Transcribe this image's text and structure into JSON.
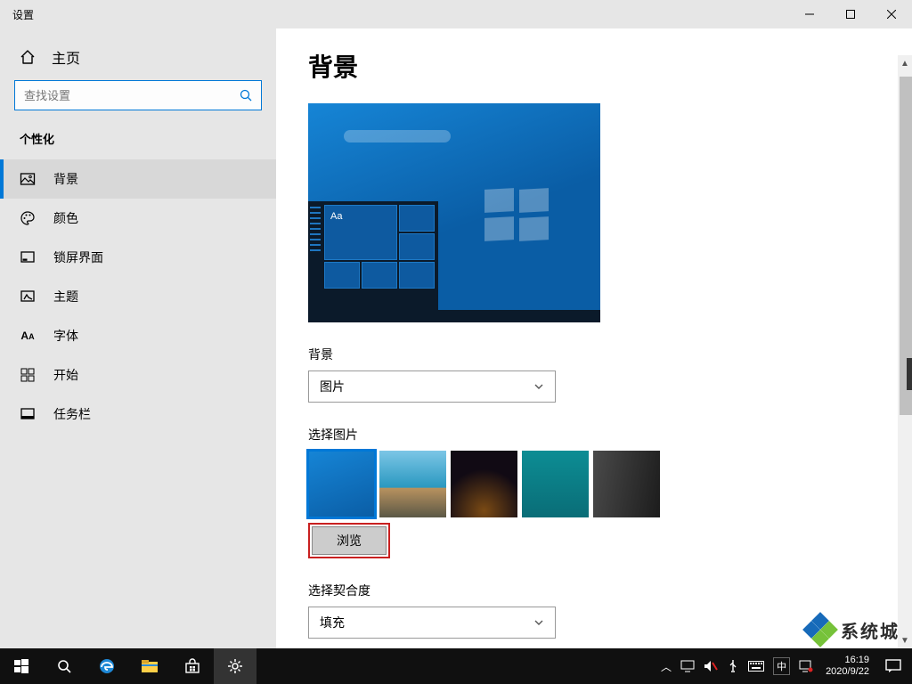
{
  "window": {
    "title": "设置"
  },
  "title_controls": {
    "min": "minimize",
    "max": "maximize",
    "close": "close"
  },
  "sidebar": {
    "home_label": "主页",
    "search_placeholder": "查找设置",
    "section": "个性化",
    "items": [
      {
        "label": "背景",
        "icon": "picture-icon",
        "active": true
      },
      {
        "label": "颜色",
        "icon": "palette-icon",
        "active": false
      },
      {
        "label": "锁屏界面",
        "icon": "lockscreen-icon",
        "active": false
      },
      {
        "label": "主题",
        "icon": "theme-icon",
        "active": false
      },
      {
        "label": "字体",
        "icon": "font-icon",
        "active": false
      },
      {
        "label": "开始",
        "icon": "start-icon",
        "active": false
      },
      {
        "label": "任务栏",
        "icon": "taskbar-icon",
        "active": false
      }
    ]
  },
  "content": {
    "heading": "背景",
    "preview_sample_text": "Aa",
    "background_label": "背景",
    "background_value": "图片",
    "choose_picture_label": "选择图片",
    "browse_label": "浏览",
    "fit_label": "选择契合度",
    "fit_value": "填充"
  },
  "taskbar": {
    "tray_lang": "中",
    "time": "16:19",
    "date": "2020/9/22"
  },
  "watermark": {
    "text": "系统城"
  }
}
